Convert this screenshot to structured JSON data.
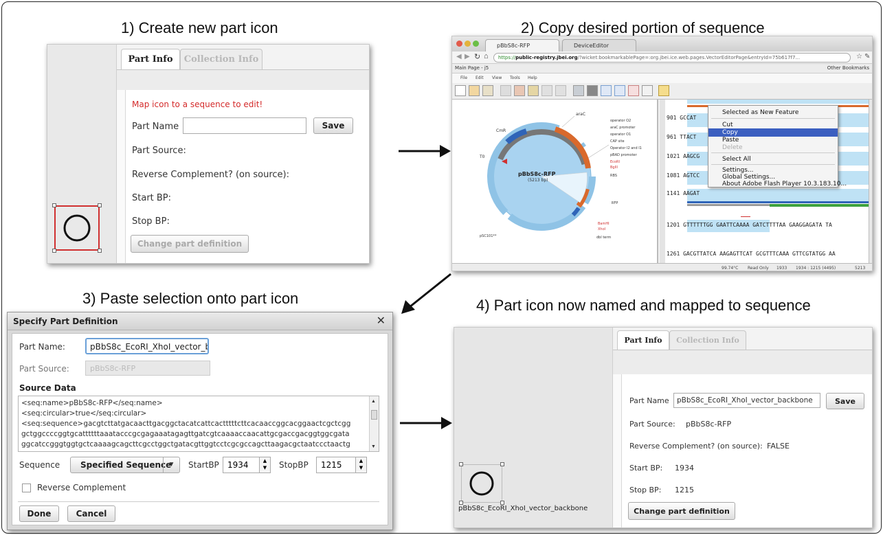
{
  "figure": {
    "step1_title": "1) Create new part icon",
    "step2_title": "2) Copy desired portion of sequence",
    "step3_title": "3) Paste selection onto part icon",
    "step4_title": "4) Part icon now named and mapped to sequence"
  },
  "panel1": {
    "tab_part_info": "Part Info",
    "tab_collection_info": "Collection Info",
    "warning": "Map icon to a sequence to edit!",
    "part_name_label": "Part Name",
    "part_name_value": "",
    "save_label": "Save",
    "part_source_label": "Part Source:",
    "reverse_label": "Reverse Complement? (on source):",
    "start_label": "Start BP:",
    "stop_label": "Stop BP:",
    "change_label": "Change part definition"
  },
  "panel2": {
    "tab1": "pBbS8c-RFP",
    "tab2": "DeviceEditor",
    "url_scheme": "https://",
    "url_host": "public-registry.jbei.org",
    "url_rest": "/?wicket:bookmarkablePage=:org.jbei.ice.web.pages.VectorEditorPage&entryId=75b617f7...",
    "bookmark_left": "Main Page - j5",
    "bookmark_right": "Other Bookmarks",
    "menus": [
      "File",
      "Edit",
      "View",
      "Tools",
      "Help"
    ],
    "plasmid_name": "pBbS8c-RFP",
    "plasmid_size": "(5213 bp)",
    "feature_labels": [
      "araC",
      "operator O2",
      "araC promoter",
      "operator O1",
      "CAP site",
      "Operator I2 and I1",
      "pBAD promoter",
      "EcoRI",
      "BglII",
      "RBS",
      "RFP",
      "BamHI",
      "XhoI",
      "dbl term",
      "pSC101**",
      "CmR",
      "T0"
    ],
    "seq_rows": [
      {
        "num": "901",
        "text": "GCCAT"
      },
      {
        "num": "961",
        "text": "TTACT"
      },
      {
        "num": "1021",
        "text": "AAGCG"
      },
      {
        "num": "1081",
        "text": "AGTCC"
      },
      {
        "num": "1141",
        "text": "AAGAT"
      },
      {
        "num": "1201",
        "text": "GTTTTTTGG GAATTCAAAA GATCTTTTAA GAAGGAGATA TA"
      },
      {
        "num": "1261",
        "text": "GACGTTATCA AAGAGTTCAT GCGTTTCAAA GTTCGTATGG AA"
      }
    ],
    "context_menu": [
      "Selected as New Feature",
      "Cut",
      "Copy",
      "Paste",
      "Delete",
      "Select All",
      "Settings...",
      "Global Settings...",
      "About Adobe Flash Player 10.3.183.10..."
    ],
    "status": [
      "99.74°C",
      "Read Only",
      "1933",
      "1934 : 1215 (4495)",
      "5213"
    ]
  },
  "panel3": {
    "dialog_title": "Specify Part Definition",
    "part_name_label": "Part Name:",
    "part_name_value": "pBbS8c_EcoRI_XhoI_vector_b",
    "part_source_label": "Part Source:",
    "part_source_value": "pBbS8c-RFP",
    "source_data_label": "Source Data",
    "source_lines": [
      "<seq:name>pBbS8c-RFP</seq:name>",
      "<seq:circular>true</seq:circular>",
      "<seq:sequence>gacgtcttatgacaacttgacggctacatcattcactttttcttcacaaccggcacggaactcgctcgg",
      "gctggccccggtgcattttttaaatacccgcgagaaatagagttgatcgtcaaaaccaacattgcgaccgacggtggcgata",
      "ggcatccgggtggtgctcaaaagcagcttcgcctggctgatacgttggtcctcgcgccagcttaagacgctaatccctaactg"
    ],
    "sequence_label": "Sequence",
    "sequence_select": "Specified Sequence",
    "startbp_label": "StartBP",
    "startbp_value": "1934",
    "stopbp_label": "StopBP",
    "stopbp_value": "1215",
    "reverse_label": "Reverse Complement",
    "done_label": "Done",
    "cancel_label": "Cancel"
  },
  "panel4": {
    "tab_part_info": "Part Info",
    "tab_collection_info": "Collection Info",
    "part_name_label": "Part Name",
    "part_name_value": "pBbS8c_EcoRI_XhoI_vector_backbone",
    "save_label": "Save",
    "part_source_label": "Part Source:",
    "part_source_value": "pBbS8c-RFP",
    "reverse_label": "Reverse Complement? (on source):",
    "reverse_value": "FALSE",
    "start_label": "Start BP:",
    "start_value": "1934",
    "stop_label": "Stop BP:",
    "stop_value": "1215",
    "change_label": "Change part definition",
    "icon_caption": "pBbS8c_EcoRI_XhoI_vector_backbone"
  },
  "colors": {
    "warning": "#d42a2a",
    "selection": "#d03030",
    "menu_highlight": "#3b5fc0",
    "plasmid_fill": "#a9d3f0"
  }
}
